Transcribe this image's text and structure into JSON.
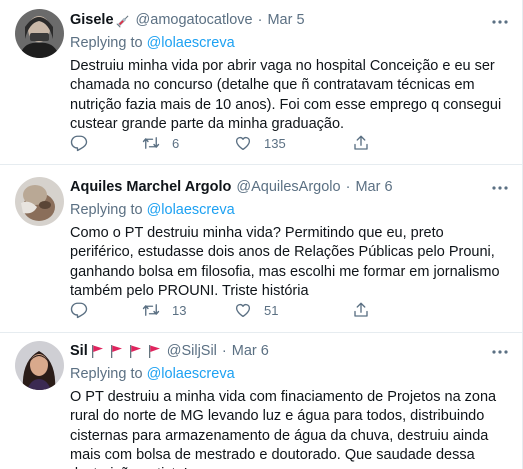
{
  "tweets": [
    {
      "name": "Gisele",
      "handle": "@amogatocatlove",
      "sep": "·",
      "date": "Mar 5",
      "replying_prefix": "Replying to",
      "replying_to": "@lolaescreva",
      "text": "Destruiu minha vida por abrir vaga no hospital Conceição e eu ser chamada no concurso (detalhe que ñ contratavam técnicas em nutrição fazia mais de 10 anos). Foi com esse emprego q consegui custear grande parte da minha graduação.",
      "reply_count": "",
      "retweet_count": "6",
      "like_count": "135"
    },
    {
      "name": "Aquiles Marchel Argolo",
      "handle": "@AquilesArgolo",
      "sep": "·",
      "date": "Mar 6",
      "replying_prefix": "Replying to",
      "replying_to": "@lolaescreva",
      "text": "Como o PT destruiu minha vida? Permitindo que eu, preto periférico, estudasse dois anos de Relações Públicas pelo Prouni, ganhando bolsa em filosofia, mas escolhi me formar em jornalismo também pelo PROUNI. Triste história",
      "reply_count": "",
      "retweet_count": "13",
      "like_count": "51"
    },
    {
      "name": "Sil",
      "handle": "@SiljSil",
      "sep": "·",
      "date": "Mar 6",
      "replying_prefix": "Replying to",
      "replying_to": "@lolaescreva",
      "text": "O PT destruiu a minha vida  com finaciamento de Projetos na zona rural do norte de MG levando luz e água para todos, distribuindo cisternas para armazenamento de água da chuva, destruiu ainda mais com  bolsa de mestrado e doutorado. Que saudade dessa destruição petista!"
    }
  ],
  "colors": {
    "text": "#0f1419",
    "secondary": "#5b7083",
    "link": "#1da1f2",
    "divider": "#e6ecf0",
    "flag": "#e0245e"
  },
  "icons": [
    "syringe-icon",
    "more-icon",
    "reply-icon",
    "retweet-icon",
    "like-icon",
    "share-icon",
    "red-flag-icon"
  ]
}
